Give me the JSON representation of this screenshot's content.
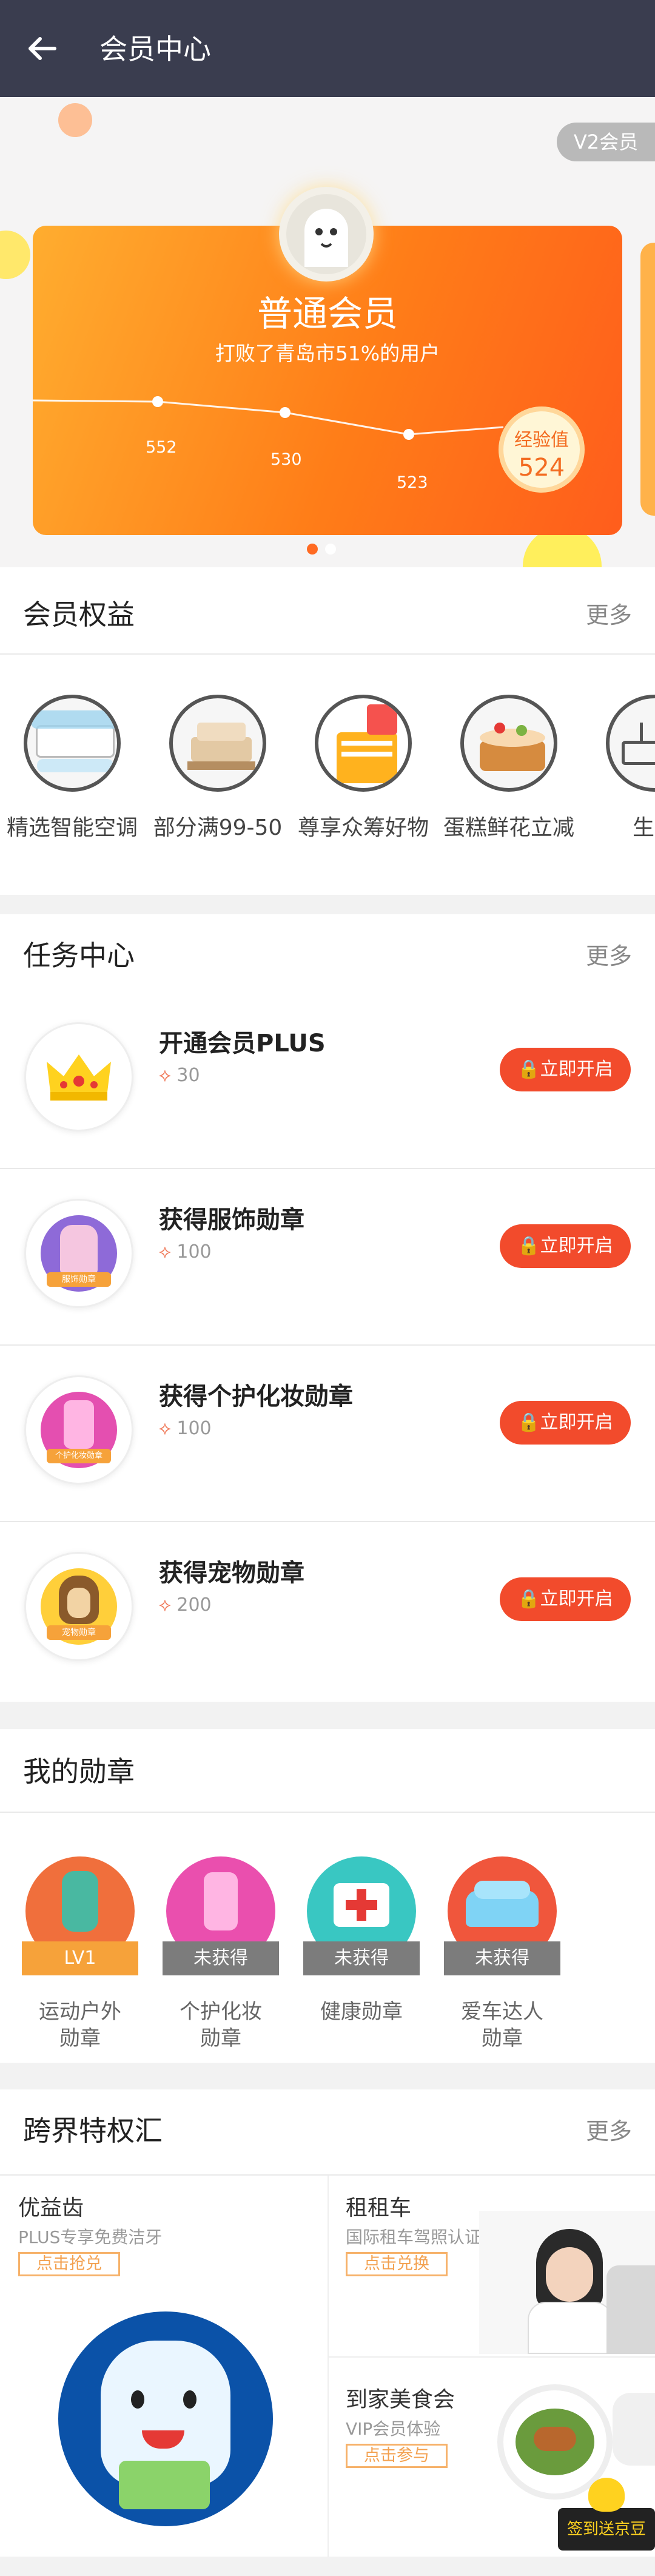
{
  "header": {
    "title": "会员中心"
  },
  "hero": {
    "badge": "V2会员",
    "level_name": "普通会员",
    "level_desc": "打败了青岛市51%的用户",
    "experience_label": "经验值",
    "experience_value": "524",
    "trend_points": [
      552,
      530,
      523
    ]
  },
  "benefits": {
    "title": "会员权益",
    "more": "更多",
    "items": [
      {
        "label": "精选智能空调",
        "icon": "air-conditioner-icon"
      },
      {
        "label": "部分满99-50",
        "icon": "furniture-icon"
      },
      {
        "label": "尊享众筹好物",
        "icon": "shopping-bag-icon"
      },
      {
        "label": "蛋糕鲜花立减",
        "icon": "cake-icon"
      },
      {
        "label": "生日",
        "icon": "birthday-icon"
      }
    ]
  },
  "tasks": {
    "title": "任务中心",
    "more": "更多",
    "items": [
      {
        "name": "开通会员PLUS",
        "points": "30",
        "button": "立即开启"
      },
      {
        "name": "获得服饰勋章",
        "points": "100",
        "button": "立即开启"
      },
      {
        "name": "获得个护化妆勋章",
        "points": "100",
        "button": "立即开启"
      },
      {
        "name": "获得宠物勋章",
        "points": "200",
        "button": "立即开启"
      }
    ],
    "medal_texts": [
      "服饰勋章",
      "个护化妆勋章",
      "宠物勋章"
    ]
  },
  "medals": {
    "title": "我的勋章",
    "items": [
      {
        "ribbon": "LV1",
        "label": "运动户外\n勋章"
      },
      {
        "ribbon": "未获得",
        "label": "个护化妆\n勋章"
      },
      {
        "ribbon": "未获得",
        "label": "健康勋章"
      },
      {
        "ribbon": "未获得",
        "label": "爱车达人\n勋章"
      }
    ]
  },
  "cross": {
    "title": "跨界特权汇",
    "more": "更多",
    "items": [
      {
        "title": "优益齿",
        "subtitle": "PLUS专享免费洁牙",
        "button": "点击抢兑"
      },
      {
        "title": "租租车",
        "subtitle": "国际租车驾照认证件",
        "button": "点击兑换"
      },
      {
        "title": "到家美食会",
        "subtitle": "VIP会员体验",
        "button": "点击参与"
      }
    ],
    "sign_badge": "签到送京豆"
  },
  "colors": {
    "header": "#3a3d4f",
    "accent": "#f24b2c",
    "orange": "#ff7d18"
  }
}
